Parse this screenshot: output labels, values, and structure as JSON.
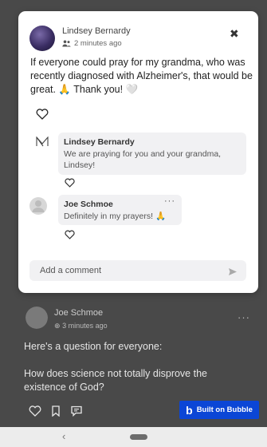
{
  "post": {
    "author": "Lindsey Bernardy",
    "timestamp": "2 minutes ago",
    "text": "If everyone could pray for my grandma, who was recently diagnosed with Alzheimer's, that would be great. 🙏 Thank you! 🤍"
  },
  "comments": [
    {
      "author": "Lindsey Bernardy",
      "text": "We are praying for you and your grandma, Lindsey!",
      "avatar_icon": "brand-logo-icon"
    },
    {
      "author": "Joe Schmoe",
      "text": "Definitely in my prayers! 🙏",
      "menu_icon": "more-dots-icon",
      "avatar_icon": "avatar-placeholder"
    }
  ],
  "composer": {
    "placeholder": "Add a comment",
    "send_icon": "send-icon"
  },
  "background_post": {
    "author": "Joe Schmoe",
    "timestamp": "3 minutes ago",
    "question": "Here's a question for everyone:",
    "body": "How does science not totally disprove the existence of God?",
    "menu": "···"
  },
  "badge": {
    "label": "Built on Bubble",
    "color": "#0b46d6"
  },
  "nav": {
    "back": "‹"
  },
  "icons": {
    "close": "✖",
    "dots": "···"
  }
}
